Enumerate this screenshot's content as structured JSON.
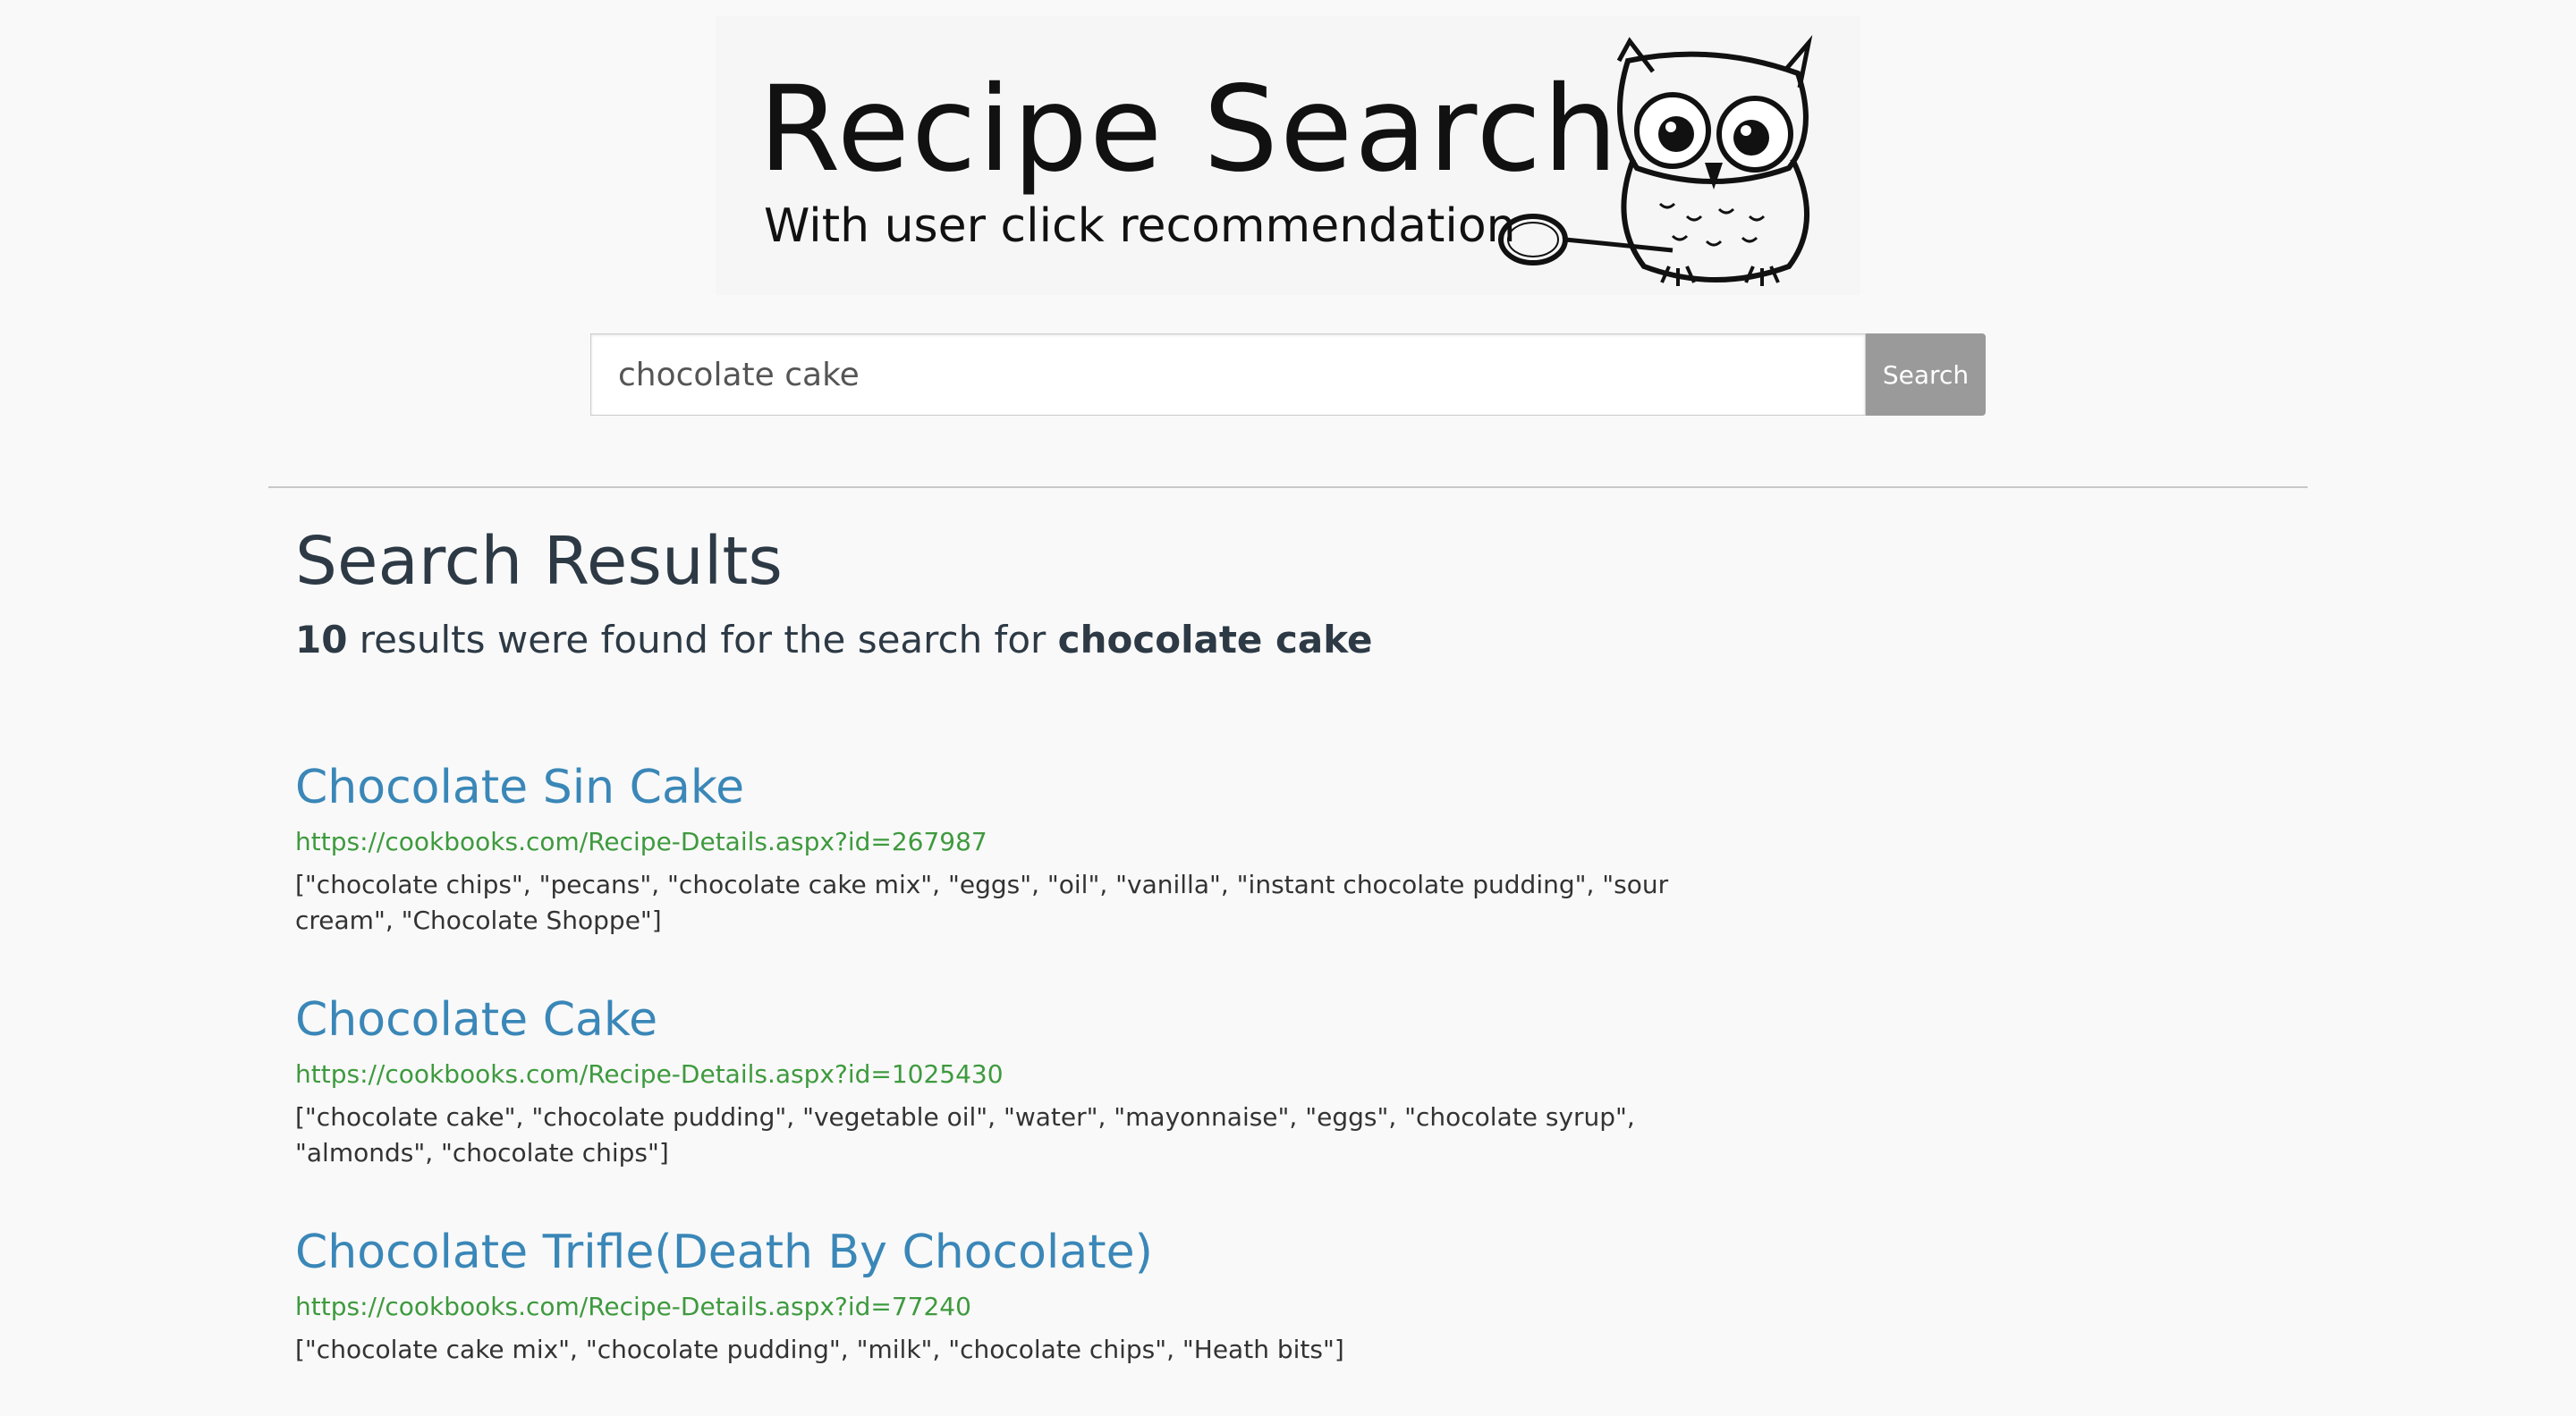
{
  "logo": {
    "title": "Recipe Search",
    "subtitle": "With user click  recommendation",
    "icon": "owl-with-magnifier-icon"
  },
  "search": {
    "value": "chocolate cake",
    "button_label": "Search"
  },
  "results": {
    "heading": "Search Results",
    "count": "10",
    "summary_text": " results were found for the search for ",
    "query": "chocolate cake",
    "items": [
      {
        "title": "Chocolate Sin Cake",
        "url": "https://cookbooks.com/Recipe-Details.aspx?id=267987",
        "ingredients": "[\"chocolate chips\", \"pecans\", \"chocolate cake mix\", \"eggs\", \"oil\", \"vanilla\", \"instant chocolate pudding\", \"sour cream\", \"Chocolate Shoppe\"]"
      },
      {
        "title": "Chocolate Cake",
        "url": "https://cookbooks.com/Recipe-Details.aspx?id=1025430",
        "ingredients": "[\"chocolate cake\", \"chocolate pudding\", \"vegetable oil\", \"water\", \"mayonnaise\", \"eggs\", \"chocolate syrup\", \"almonds\", \"chocolate chips\"]"
      },
      {
        "title": "Chocolate Trifle(Death By Chocolate)",
        "url": "https://cookbooks.com/Recipe-Details.aspx?id=77240",
        "ingredients": "[\"chocolate cake mix\", \"chocolate pudding\", \"milk\", \"chocolate chips\", \"Heath bits\"]"
      }
    ]
  },
  "colors": {
    "background": "#f9f9f9",
    "link": "#3a87b8",
    "url": "#3e9a3e",
    "button": "#9a9a9a"
  }
}
